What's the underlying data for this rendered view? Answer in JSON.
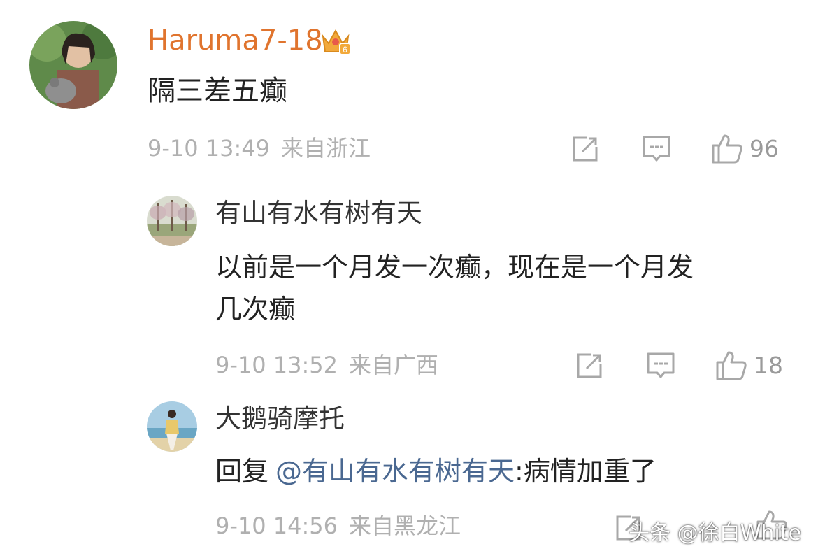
{
  "colors": {
    "username_primary": "#e0742e",
    "username_reply": "#333333",
    "body_text": "#222222",
    "meta_text": "#b0b0b0",
    "mention": "#4a6891",
    "crown": "#f0a040"
  },
  "comments": [
    {
      "username": "Haruma7-18",
      "badge_icon": "crown-level-badge-icon",
      "badge_level": "6",
      "text": "隔三差五癫",
      "date": "9-10 13:49",
      "location": "来自浙江",
      "likes": "96"
    },
    {
      "username": "有山有水有树有天",
      "text": "以前是一个月发一次癫，现在是一个月发\n几次癫",
      "date": "9-10 13:52",
      "location": "来自广西",
      "likes": "18"
    },
    {
      "username": "大鹅骑摩托",
      "reply_prefix": "回复",
      "mention": "@有山有水有树有天",
      "reply_text": ":病情加重了",
      "date": "9-10 14:56",
      "location": "来自黑龙江"
    }
  ],
  "watermark": "头条 @徐白White"
}
